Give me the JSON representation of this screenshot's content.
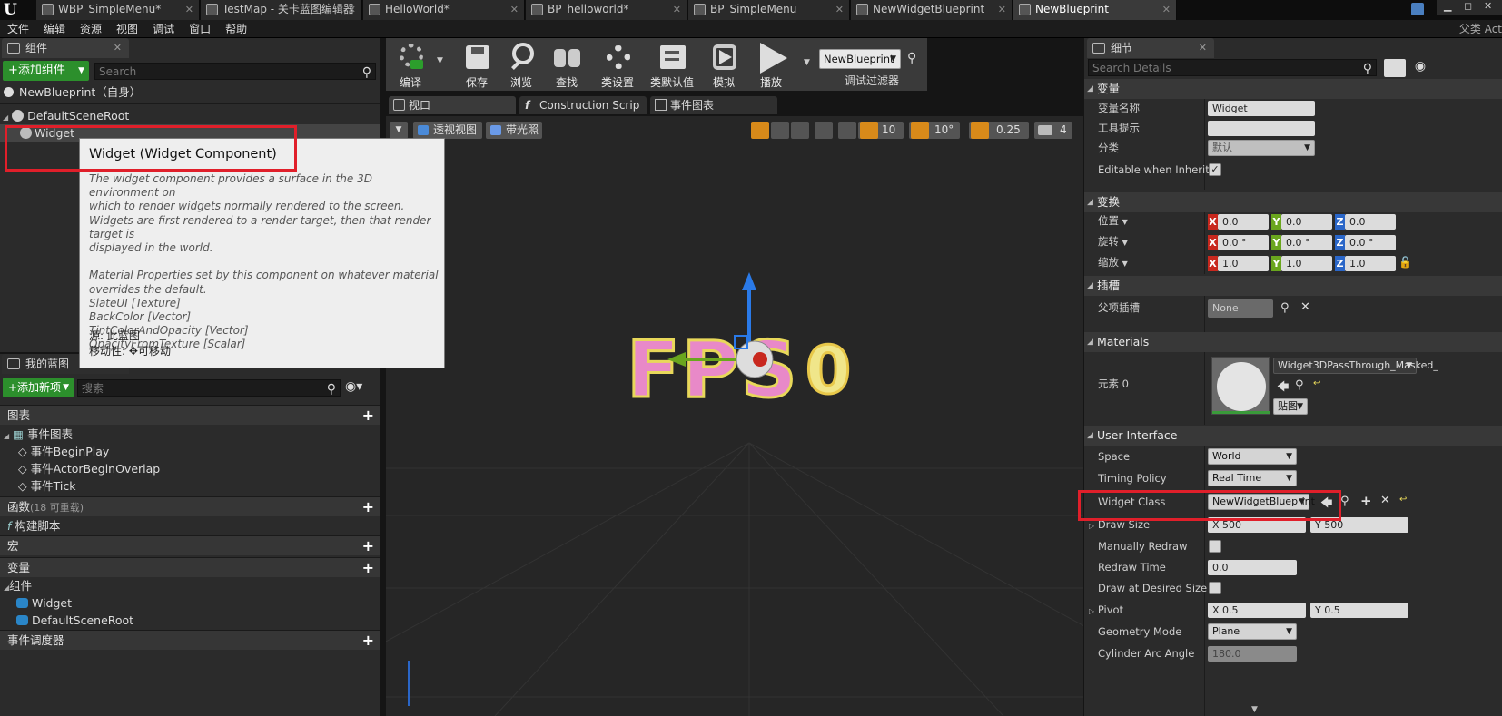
{
  "app": {
    "logo": "U"
  },
  "tabs": [
    {
      "label": "WBP_SimpleMenu*"
    },
    {
      "label": "TestMap - 关卡蓝图编辑器"
    },
    {
      "label": "HelloWorld*"
    },
    {
      "label": "BP_helloworld*"
    },
    {
      "label": "BP_SimpleMenu"
    },
    {
      "label": "NewWidgetBlueprint"
    },
    {
      "label": "NewBlueprint"
    }
  ],
  "menu": {
    "items": [
      "文件",
      "编辑",
      "资源",
      "视图",
      "调试",
      "窗口",
      "帮助"
    ],
    "right_label": "父类 Act"
  },
  "components_panel": {
    "tab": "组件",
    "add_button": "+添加组件",
    "search_placeholder": "Search",
    "self_item": "NewBlueprint（自身）",
    "tree": [
      {
        "label": "DefaultSceneRoot"
      },
      {
        "label": "Widget"
      }
    ]
  },
  "tooltip": {
    "title": "Widget (Widget Component)",
    "body": [
      "The widget component provides a surface in the 3D environment on",
      "which to render widgets normally rendered to the screen.",
      "Widgets are first rendered to a render target, then that render target is",
      "displayed in the world.",
      "",
      "Material Properties set by this component on whatever material",
      "overrides the default.",
      "SlateUI [Texture]",
      "BackColor [Vector]",
      "TintColorAndOpacity [Vector]",
      "OpacityFromTexture [Scalar]"
    ],
    "source_label": "源:",
    "source_value": "此蓝图",
    "mobility_label": "移动性:",
    "mobility_value": "可移动"
  },
  "my_blueprint": {
    "tab": "我的蓝图",
    "add_button": "+添加新项",
    "search_placeholder": "搜索",
    "sections": {
      "graphs": "图表",
      "event_graph": "事件图表",
      "events": [
        "事件BeginPlay",
        "事件ActorBeginOverlap",
        "事件Tick"
      ],
      "functions": "函数",
      "functions_count": "(18 可重载)",
      "construction": "构建脚本",
      "macros": "宏",
      "variables": "变量",
      "components": "组件",
      "component_items": [
        "Widget",
        "DefaultSceneRoot"
      ],
      "dispatchers": "事件调度器"
    }
  },
  "toolbar": {
    "buttons": [
      "编译",
      "保存",
      "浏览",
      "查找",
      "类设置",
      "类默认值",
      "模拟",
      "播放"
    ],
    "debug_select": "NewBlueprint",
    "debug_label": "调试过滤器"
  },
  "viewport_tabs": [
    {
      "label": "视口"
    },
    {
      "label": "Construction Scrip"
    },
    {
      "label": "事件图表"
    }
  ],
  "viewport": {
    "perspective": "透视视图",
    "lit": "带光照",
    "grid_snap": "10",
    "rot_snap": "10°",
    "scale_snap": "0.25",
    "cam_speed": "4",
    "fps_text": "FPS",
    "fps_value": "0"
  },
  "details": {
    "tab": "细节",
    "search_placeholder": "Search Details",
    "variable": {
      "header": "变量",
      "name_label": "变量名称",
      "name_value": "Widget",
      "tooltip_label": "工具提示",
      "tooltip_value": "",
      "category_label": "分类",
      "category_value": "默认",
      "editable_label": "Editable when Inherited"
    },
    "transform": {
      "header": "变换",
      "location_label": "位置",
      "location": [
        "0.0",
        "0.0",
        "0.0"
      ],
      "rotation_label": "旋转",
      "rotation": [
        "0.0 °",
        "0.0 °",
        "0.0 °"
      ],
      "scale_label": "缩放",
      "scale": [
        "1.0",
        "1.0",
        "1.0"
      ],
      "axes": [
        "X",
        "Y",
        "Z"
      ]
    },
    "sockets": {
      "header": "插槽",
      "parent_label": "父项插槽",
      "parent_value": "None"
    },
    "materials": {
      "header": "Materials",
      "element_label": "元素 0",
      "material_name": "Widget3DPassThrough_Masked_",
      "texture_button": "贴图"
    },
    "ui": {
      "header": "User Interface",
      "space_label": "Space",
      "space_value": "World",
      "timing_label": "Timing Policy",
      "timing_value": "Real Time",
      "class_label": "Widget Class",
      "class_value": "NewWidgetBlueprint",
      "drawsize_label": "Draw Size",
      "drawsize_x": "500",
      "drawsize_y": "500",
      "manual_label": "Manually Redraw",
      "redraw_label": "Redraw Time",
      "redraw_value": "0.0",
      "desired_label": "Draw at Desired Size",
      "pivot_label": "Pivot",
      "pivot_x": "0.5",
      "pivot_y": "0.5",
      "geometry_label": "Geometry Mode",
      "geometry_value": "Plane",
      "arc_label": "Cylinder Arc Angle",
      "arc_value": "180.0",
      "x_prefix": "X",
      "y_prefix": "Y"
    }
  },
  "colors": {
    "accent_green": "#2c8f2c",
    "highlight_red": "#e01f2a",
    "axis_x": "#c8281e",
    "axis_y": "#6aa61e",
    "axis_z": "#2a66c8",
    "fps_pink": "#e889c8",
    "fps_yellow": "#e8d85a"
  }
}
